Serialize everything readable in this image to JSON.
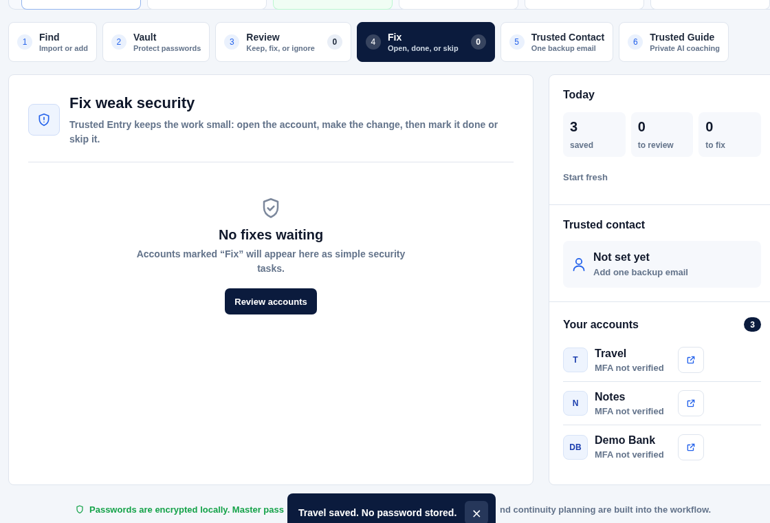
{
  "steps": [
    {
      "number": "1",
      "title": "Find",
      "subtitle": "Import or add",
      "selected": false
    },
    {
      "number": "2",
      "title": "Vault",
      "subtitle": "Protect passwords",
      "selected": false
    },
    {
      "number": "3",
      "title": "Review",
      "subtitle": "Keep, fix, or ignore",
      "count": "0",
      "selected": false
    },
    {
      "number": "4",
      "title": "Fix",
      "subtitle": "Open, done, or skip",
      "count": "0",
      "selected": true
    },
    {
      "number": "5",
      "title": "Trusted Contact",
      "subtitle": "One backup email",
      "selected": false
    },
    {
      "number": "6",
      "title": "Trusted Guide",
      "subtitle": "Private AI coaching",
      "selected": false
    }
  ],
  "main": {
    "title": "Fix weak security",
    "description": "Trusted Entry keeps the work small: open the account, make the change, then mark it done or skip it.",
    "empty_title": "No fixes waiting",
    "empty_text": "Accounts marked “Fix” will appear here as simple security tasks.",
    "button": "Review accounts"
  },
  "today": {
    "title": "Today",
    "stats": [
      {
        "value": "3",
        "label": "saved"
      },
      {
        "value": "0",
        "label": "to review"
      },
      {
        "value": "0",
        "label": "to fix"
      }
    ],
    "link": "Start fresh"
  },
  "trusted_contact": {
    "title": "Trusted contact",
    "status": "Not set yet",
    "hint": "Add one backup email"
  },
  "accounts": {
    "title": "Your accounts",
    "count": "3",
    "items": [
      {
        "initials": "T",
        "name": "Travel",
        "status": "MFA not verified"
      },
      {
        "initials": "N",
        "name": "Notes",
        "status": "MFA not verified"
      },
      {
        "initials": "DB",
        "name": "Demo Bank",
        "status": "MFA not verified"
      }
    ]
  },
  "footer": {
    "left": "Passwords are encrypted locally. Master pass",
    "right": "nd continuity planning are built into the workflow."
  },
  "toast": {
    "message": "Travel saved. No password stored.",
    "close": "×"
  }
}
